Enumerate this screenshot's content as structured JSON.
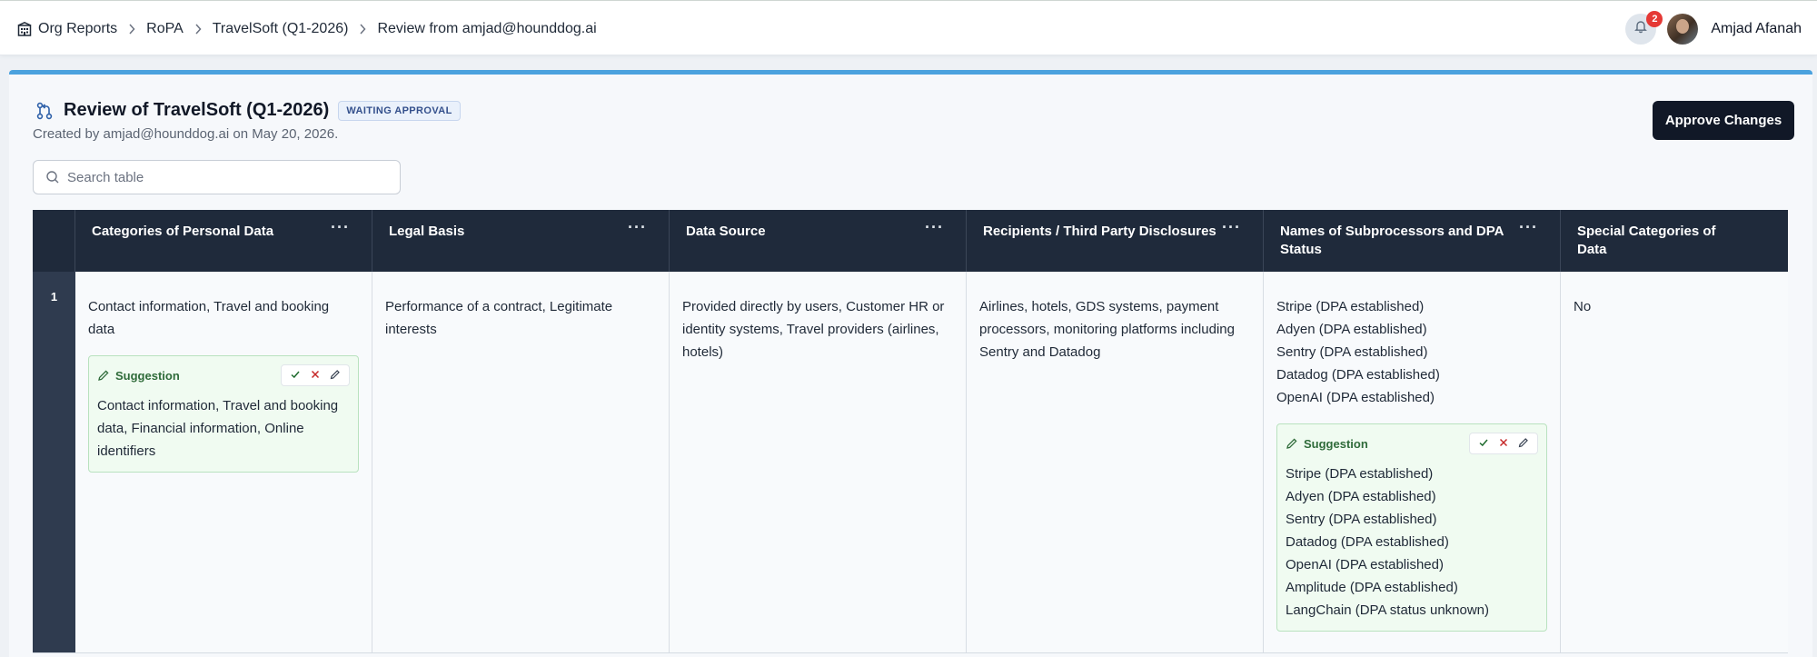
{
  "breadcrumb": {
    "items": [
      "Org Reports",
      "RoPA",
      "TravelSoft (Q1-2026)",
      "Review from amjad@hounddog.ai"
    ]
  },
  "header": {
    "notification_count": "2",
    "user_name": "Amjad Afanah"
  },
  "review": {
    "title": "Review of TravelSoft (Q1-2026)",
    "status": "WAITING APPROVAL",
    "subtitle": "Created by amjad@hounddog.ai on May 20, 2026.",
    "approve_label": "Approve Changes"
  },
  "search": {
    "placeholder": "Search table",
    "value": ""
  },
  "table": {
    "columns": [
      "Categories of Personal Data",
      "Legal Basis",
      "Data Source",
      "Recipients / Third Party Disclosures",
      "Names of Subprocessors and DPA Status",
      "Special Categories of Data"
    ],
    "rows": [
      {
        "number": "1",
        "categories": "Contact information, Travel and booking data",
        "categories_suggestion": "Contact information, Travel and booking data, Financial information, Online identifiers",
        "legal_basis": "Performance of a contract, Legitimate interests",
        "data_source": "Provided directly by users, Customer HR or identity systems, Travel providers (airlines, hotels)",
        "recipients": "Airlines, hotels, GDS systems, payment processors, monitoring platforms including Sentry and Datadog",
        "subprocessors": [
          "Stripe (DPA established)",
          "Adyen (DPA established)",
          "Sentry (DPA established)",
          "Datadog (DPA established)",
          "OpenAI (DPA established)"
        ],
        "subprocessors_suggestion": [
          "Stripe (DPA established)",
          "Adyen (DPA established)",
          "Sentry (DPA established)",
          "Datadog (DPA established)",
          "OpenAI (DPA established)",
          "Amplitude (DPA established)",
          "LangChain (DPA status unknown)"
        ],
        "special_categories": "No"
      }
    ],
    "suggestion_label": "Suggestion"
  },
  "colors": {
    "header_bg": "#1f2a3b",
    "accent": "#4ba2de",
    "suggestion_bg": "#f0fbf1",
    "badge": "#e53935"
  },
  "icons": [
    "org-building-icon",
    "chevron-right-icon",
    "bell-icon",
    "pull-request-icon",
    "search-icon",
    "more-dots-icon",
    "pencil-icon",
    "check-icon",
    "close-icon",
    "edit-icon"
  ]
}
